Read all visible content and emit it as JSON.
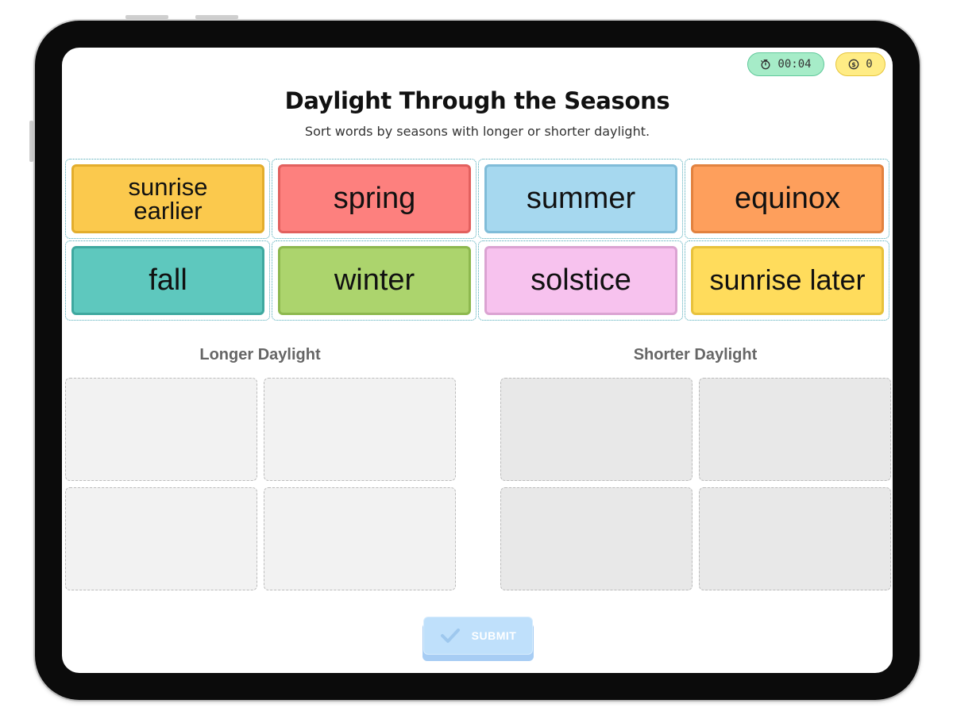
{
  "game": {
    "title": "Daylight Through the Seasons",
    "subtitle": "Sort words by seasons with longer or shorter daylight."
  },
  "hud": {
    "timer": "00:04",
    "timer_icon": "timer-icon",
    "coins": "0",
    "coin_icon": "coin-icon"
  },
  "cards": [
    {
      "label": "sunrise earlier",
      "color": "#fbc94d",
      "border": "#e3ad2c"
    },
    {
      "label": "spring",
      "color": "#fd807e",
      "border": "#e2605e"
    },
    {
      "label": "summer",
      "color": "#a6d8ef",
      "border": "#80bcd8"
    },
    {
      "label": "equinox",
      "color": "#fe9f5c",
      "border": "#e2823f"
    },
    {
      "label": "fall",
      "color": "#5ec8be",
      "border": "#3ea89f"
    },
    {
      "label": "winter",
      "color": "#acd46d",
      "border": "#8db84e"
    },
    {
      "label": "solstice",
      "color": "#f7c2ee",
      "border": "#dba3d2"
    },
    {
      "label": "sunrise later",
      "color": "#ffdc5c",
      "border": "#e8c23c"
    }
  ],
  "zones": {
    "left_label": "Longer Daylight",
    "right_label": "Shorter Daylight"
  },
  "submit": {
    "label": "SUBMIT",
    "icon": "check-icon"
  }
}
